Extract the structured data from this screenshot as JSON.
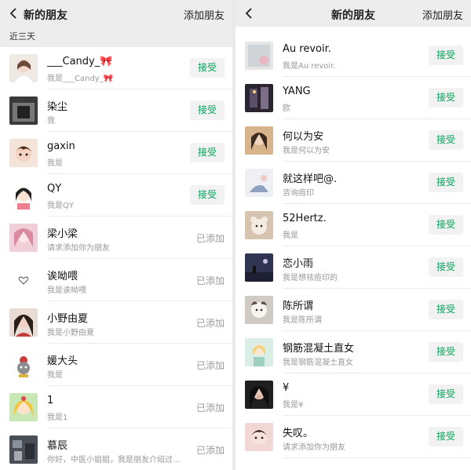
{
  "left_panel": {
    "title": "新的朋友",
    "add_friend_label": "添加朋友",
    "section_label": "近三天",
    "items": [
      {
        "name": "___Candy_🎀",
        "sub": "我是___Candy_🎀",
        "action": "接受",
        "accepted": false
      },
      {
        "name": "染尘",
        "sub": "我",
        "action": "接受",
        "accepted": false
      },
      {
        "name": "gaxin",
        "sub": "我是",
        "action": "接受",
        "accepted": false
      },
      {
        "name": "QY",
        "sub": "我是QY",
        "action": "接受",
        "accepted": false
      },
      {
        "name": "梁小梁",
        "sub": "请求添加你为朋友",
        "action": "已添加",
        "accepted": true
      },
      {
        "name": "诶呦喂",
        "sub": "我是诶呦喂",
        "action": "已添加",
        "accepted": true
      },
      {
        "name": "小野由夏",
        "sub": "我是小野由夏",
        "action": "已添加",
        "accepted": true
      },
      {
        "name": "媛大头",
        "sub": "我是",
        "action": "已添加",
        "accepted": true
      },
      {
        "name": "1",
        "sub": "我是1",
        "action": "已添加",
        "accepted": true
      },
      {
        "name": "慕辰",
        "sub": "你好，中医小姐姐，我是朋友介绍过...",
        "action": "已添加",
        "accepted": true
      }
    ]
  },
  "right_panel": {
    "title": "新的朋友",
    "add_friend_label": "添加朋友",
    "items": [
      {
        "name": "Au revoir.",
        "sub": "我是Au revoir.",
        "action": "接受"
      },
      {
        "name": "YANG",
        "sub": "欧",
        "action": "接受"
      },
      {
        "name": "何以为安",
        "sub": "我是何以为安",
        "action": "接受"
      },
      {
        "name": "就这样吧@.",
        "sub": "咨询痘印",
        "action": "接受"
      },
      {
        "name": "52Hertz.",
        "sub": "我是",
        "action": "接受"
      },
      {
        "name": "恋小雨",
        "sub": "我是想祛痘印的",
        "action": "接受"
      },
      {
        "name": "陈所谓",
        "sub": "我是陈所谓",
        "action": "接受"
      },
      {
        "name": "钢筋混凝土直女",
        "sub": "我是钢筋混凝土直女",
        "action": "接受"
      },
      {
        "name": "¥",
        "sub": "我是¥",
        "action": "接受"
      },
      {
        "name": "失叹。",
        "sub": "请求添加你为朋友",
        "action": "接受"
      }
    ]
  },
  "colors": {
    "accept_text": "#07a35a",
    "accept_bg": "#f2f2f2",
    "header_bg": "#ededed",
    "added_text": "#9a9a9a"
  }
}
